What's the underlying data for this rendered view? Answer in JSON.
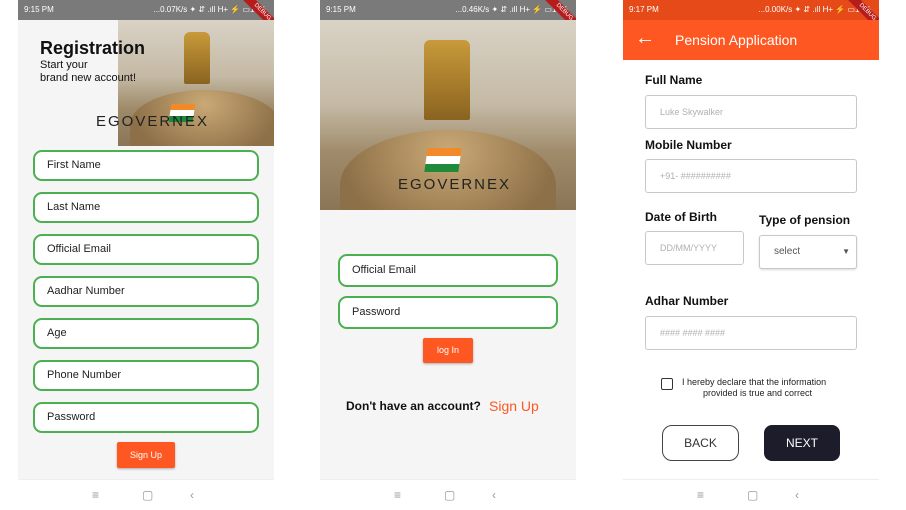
{
  "status": {
    "p1": {
      "time": "9:15 PM",
      "net": "...0.07K/s ✦ ⇵ .ıll H+ ⚡ ▭13%"
    },
    "p2": {
      "time": "9:15 PM",
      "net": "...0.46K/s ✦ ⇵ .ıll H+ ⚡ ▭13%"
    },
    "p3": {
      "time": "9:17 PM",
      "net": "...0.00K/s ✦ ⇵ .ıll H+ ⚡ ▭13%"
    },
    "debug_label": "DEBUG"
  },
  "registration": {
    "title": "Registration",
    "subtitle_line1": "Start  your",
    "subtitle_line2": "brand new  account!",
    "brand": "EGOVERNEX",
    "fields": [
      "First Name",
      "Last Name",
      "Official Email",
      "Aadhar Number",
      "Age",
      "Phone Number",
      "Password"
    ],
    "submit_label": "Sign Up"
  },
  "login": {
    "brand": "EGOVERNEX",
    "email_placeholder": "Official Email",
    "password_placeholder": "Password",
    "login_label": "log In",
    "no_account_text": "Don't have an account?",
    "signup_link": "Sign Up"
  },
  "pension": {
    "appbar_title": "Pension Application",
    "full_name_label": "Full Name",
    "full_name_value": "Luke Skywalker",
    "mobile_label": "Mobile Number",
    "mobile_placeholder": "+91- ##########",
    "dob_label": "Date of Birth",
    "dob_placeholder": "DD/MM/YYYY",
    "pension_type_label": "Type of pension",
    "pension_type_value": "select",
    "adhar_label": "Adhar Number",
    "adhar_placeholder": "#### #### ####",
    "declare_line1": "I hereby declare that the information",
    "declare_line2": "provided is true and correct",
    "back_label": "BACK",
    "next_label": "NEXT"
  },
  "navbar": {
    "menu_icon": "≡",
    "home_icon": "▢",
    "back_icon": "‹"
  },
  "colors": {
    "accent": "#ff5722",
    "field_border": "#4caf50",
    "next_button": "#1c1c2a"
  }
}
